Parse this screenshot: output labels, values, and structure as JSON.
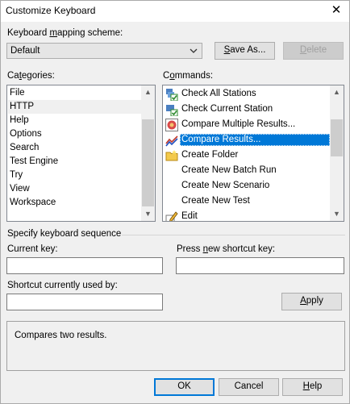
{
  "window": {
    "title": "Customize Keyboard",
    "close_glyph": "✕"
  },
  "scheme": {
    "label_pre": "Keyboard ",
    "label_u": "m",
    "label_post": "apping scheme:",
    "value": "Default",
    "save_as_pre": "",
    "save_as_u": "S",
    "save_as_post": "ave As...",
    "delete_pre": "",
    "delete_u": "D",
    "delete_post": "elete"
  },
  "categories": {
    "label_pre": "Ca",
    "label_u": "t",
    "label_post": "egories:",
    "items": [
      "File",
      "HTTP",
      "Help",
      "Options",
      "Search",
      "Test Engine",
      "Try",
      "View",
      "Workspace"
    ],
    "selected_index": 1
  },
  "commands": {
    "label_pre": "C",
    "label_u": "o",
    "label_post": "mmands:",
    "items": [
      {
        "label": "Check All Stations",
        "icon": "stations-check-icon"
      },
      {
        "label": "Check Current Station",
        "icon": "station-check-icon"
      },
      {
        "label": "Compare Multiple Results...",
        "icon": "compare-multiple-icon"
      },
      {
        "label": "Compare Results...",
        "icon": "compare-results-icon"
      },
      {
        "label": "Create Folder",
        "icon": "folder-icon"
      },
      {
        "label": "Create New Batch Run",
        "icon": ""
      },
      {
        "label": "Create New Scenario",
        "icon": ""
      },
      {
        "label": "Create New Test",
        "icon": ""
      },
      {
        "label": "Edit",
        "icon": "edit-icon"
      }
    ],
    "selected_index": 3
  },
  "sequence": {
    "section_label": "Specify keyboard sequence",
    "current_key_label": "Current key:",
    "current_key_value": "",
    "press_new_pre": "Press ",
    "press_new_u": "n",
    "press_new_post": "ew shortcut key:",
    "new_key_value": "",
    "used_by_label": "Shortcut currently used by:",
    "used_by_value": "",
    "apply_pre": "",
    "apply_u": "A",
    "apply_post": "pply"
  },
  "description": "Compares two results.",
  "footer": {
    "ok": "OK",
    "cancel": "Cancel",
    "help_pre": "",
    "help_u": "H",
    "help_post": "elp"
  },
  "colors": {
    "selection": "#0078d7",
    "window_bg": "#f0f0f0"
  }
}
